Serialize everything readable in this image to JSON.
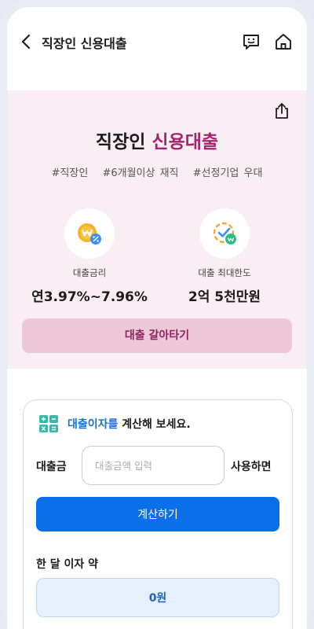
{
  "header": {
    "title": "직장인 신용대출",
    "icons": [
      "chevron-left-icon",
      "chat-icon",
      "home-icon"
    ]
  },
  "hero": {
    "title_prefix": "직장인",
    "title_accent": "신용대출",
    "accent_color": "#a4256b",
    "background_color": "#f9eef4",
    "tags": [
      "#직장인",
      "#6개월이상 재직",
      "#선정기업 우대"
    ],
    "stats": [
      {
        "label": "대출금리",
        "value": "연3.97%~7.96%",
        "icon": "won-coin-percent-icon"
      },
      {
        "label": "대출 최대한도",
        "value": "2억 5천만원",
        "icon": "limit-check-icon"
      }
    ],
    "switch_button_label": "대출 갈아타기"
  },
  "calculator": {
    "heading_accent": "대출이자를",
    "heading_rest": "계산해 보세요.",
    "amount_label": "대출금",
    "amount_placeholder": "대출금액 입력",
    "amount_value": "",
    "use_label": "사용하면",
    "calculate_button_label": "계산하기",
    "monthly_label": "한 달 이자 약",
    "monthly_result": "0원",
    "primary_color": "#0a6fe8"
  }
}
